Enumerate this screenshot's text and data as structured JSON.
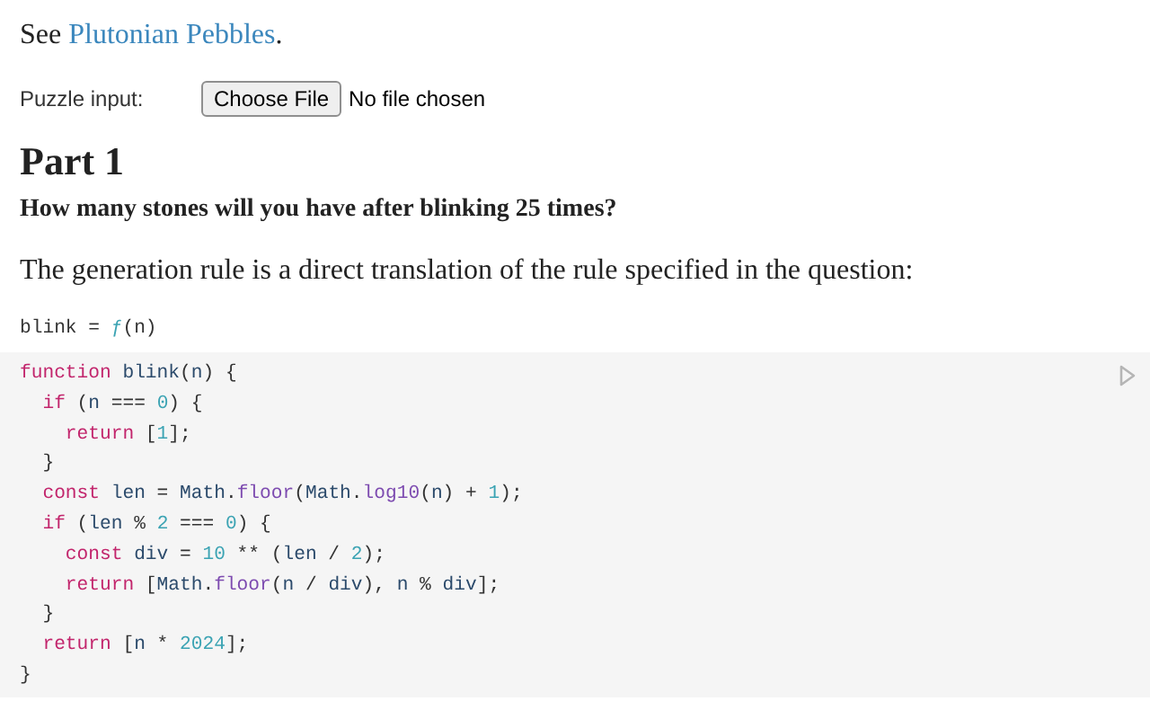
{
  "intro": {
    "before": "See ",
    "link": "Plutonian Pebbles",
    "after": "."
  },
  "puzzle_input": {
    "label": "Puzzle input:",
    "button": "Choose File",
    "status": "No file chosen"
  },
  "heading": "Part 1",
  "question": "How many stones will you have after blinking 25 times?",
  "paragraph": "The generation rule is a direct translation of the rule specified in the question:",
  "signature": [
    {
      "text": "blink = ",
      "kind": "plain"
    },
    {
      "text": "ƒ",
      "kind": "number"
    },
    {
      "text": "(n)",
      "kind": "plain"
    }
  ],
  "code": [
    [
      {
        "text": "function",
        "kind": "keyword"
      },
      {
        "text": " blink",
        "kind": "name"
      },
      {
        "text": "(",
        "kind": "plain"
      },
      {
        "text": "n",
        "kind": "name"
      },
      {
        "text": ") {",
        "kind": "plain"
      }
    ],
    [
      {
        "text": "  if",
        "kind": "keyword"
      },
      {
        "text": " (",
        "kind": "plain"
      },
      {
        "text": "n",
        "kind": "name"
      },
      {
        "text": " === ",
        "kind": "plain"
      },
      {
        "text": "0",
        "kind": "number"
      },
      {
        "text": ") {",
        "kind": "plain"
      }
    ],
    [
      {
        "text": "    return",
        "kind": "keyword"
      },
      {
        "text": " [",
        "kind": "plain"
      },
      {
        "text": "1",
        "kind": "number"
      },
      {
        "text": "];",
        "kind": "plain"
      }
    ],
    [
      {
        "text": "  }",
        "kind": "plain"
      }
    ],
    [
      {
        "text": "  const",
        "kind": "keyword"
      },
      {
        "text": " len",
        "kind": "name"
      },
      {
        "text": " = ",
        "kind": "plain"
      },
      {
        "text": "Math",
        "kind": "name"
      },
      {
        "text": ".",
        "kind": "plain"
      },
      {
        "text": "floor",
        "kind": "method"
      },
      {
        "text": "(",
        "kind": "plain"
      },
      {
        "text": "Math",
        "kind": "name"
      },
      {
        "text": ".",
        "kind": "plain"
      },
      {
        "text": "log10",
        "kind": "method"
      },
      {
        "text": "(",
        "kind": "plain"
      },
      {
        "text": "n",
        "kind": "name"
      },
      {
        "text": ") + ",
        "kind": "plain"
      },
      {
        "text": "1",
        "kind": "number"
      },
      {
        "text": ");",
        "kind": "plain"
      }
    ],
    [
      {
        "text": "  if",
        "kind": "keyword"
      },
      {
        "text": " (",
        "kind": "plain"
      },
      {
        "text": "len",
        "kind": "name"
      },
      {
        "text": " % ",
        "kind": "plain"
      },
      {
        "text": "2",
        "kind": "number"
      },
      {
        "text": " === ",
        "kind": "plain"
      },
      {
        "text": "0",
        "kind": "number"
      },
      {
        "text": ") {",
        "kind": "plain"
      }
    ],
    [
      {
        "text": "    const",
        "kind": "keyword"
      },
      {
        "text": " div",
        "kind": "name"
      },
      {
        "text": " = ",
        "kind": "plain"
      },
      {
        "text": "10",
        "kind": "number"
      },
      {
        "text": " ** (",
        "kind": "plain"
      },
      {
        "text": "len",
        "kind": "name"
      },
      {
        "text": " / ",
        "kind": "plain"
      },
      {
        "text": "2",
        "kind": "number"
      },
      {
        "text": ");",
        "kind": "plain"
      }
    ],
    [
      {
        "text": "    return",
        "kind": "keyword"
      },
      {
        "text": " [",
        "kind": "plain"
      },
      {
        "text": "Math",
        "kind": "name"
      },
      {
        "text": ".",
        "kind": "plain"
      },
      {
        "text": "floor",
        "kind": "method"
      },
      {
        "text": "(",
        "kind": "plain"
      },
      {
        "text": "n",
        "kind": "name"
      },
      {
        "text": " / ",
        "kind": "plain"
      },
      {
        "text": "div",
        "kind": "name"
      },
      {
        "text": "), ",
        "kind": "plain"
      },
      {
        "text": "n",
        "kind": "name"
      },
      {
        "text": " % ",
        "kind": "plain"
      },
      {
        "text": "div",
        "kind": "name"
      },
      {
        "text": "];",
        "kind": "plain"
      }
    ],
    [
      {
        "text": "  }",
        "kind": "plain"
      }
    ],
    [
      {
        "text": "  return",
        "kind": "keyword"
      },
      {
        "text": " [",
        "kind": "plain"
      },
      {
        "text": "n",
        "kind": "name"
      },
      {
        "text": " * ",
        "kind": "plain"
      },
      {
        "text": "2024",
        "kind": "number"
      },
      {
        "text": "];",
        "kind": "plain"
      }
    ],
    [
      {
        "text": "}",
        "kind": "plain"
      }
    ]
  ]
}
